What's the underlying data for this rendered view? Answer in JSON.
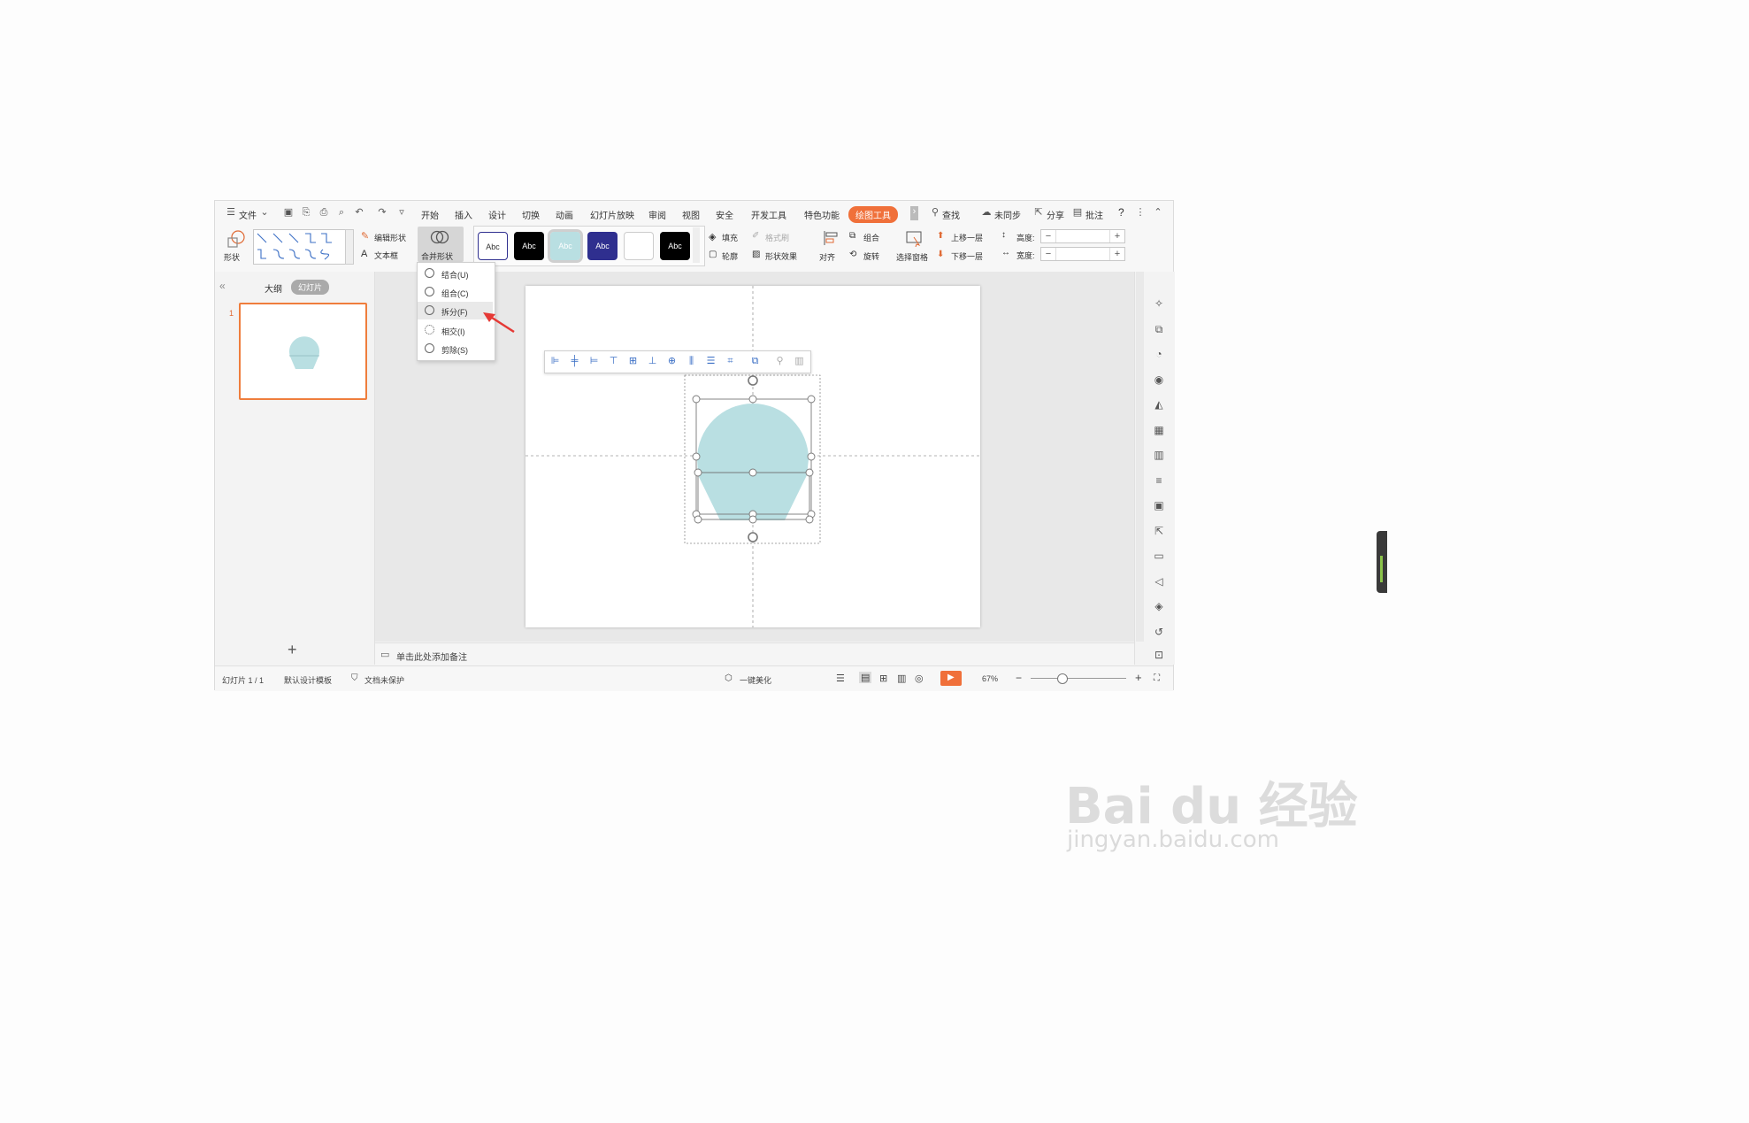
{
  "menubar": {
    "file": "文件",
    "tabs": [
      "开始",
      "插入",
      "设计",
      "切换",
      "动画",
      "幻灯片放映",
      "审阅",
      "视图",
      "安全",
      "开发工具",
      "特色功能"
    ],
    "active_tab": "绘图工具",
    "search": "查找",
    "sync": "未同步",
    "share": "分享",
    "comment": "批注",
    "help": "?"
  },
  "ribbon": {
    "shape": "形状",
    "edit_shape": "编辑形状",
    "textbox": "文本框",
    "merge_shape": "合并形状",
    "style_samples": [
      "Abc",
      "Abc",
      "Abc",
      "Abc",
      "",
      "Abc"
    ],
    "fill": "填充",
    "format_brush": "格式刷",
    "outline": "轮廓",
    "shape_effect": "形状效果",
    "align": "对齐",
    "group": "组合",
    "rotate": "旋转",
    "selection_pane": "选择窗格",
    "bring_forward": "上移一层",
    "send_backward": "下移一层",
    "height": "高度:",
    "width": "宽度:",
    "minus": "−",
    "plus": "+"
  },
  "left_panel": {
    "outline_tab": "大纲",
    "slides_tab": "幻灯片",
    "slide_number": "1",
    "add": "+",
    "collapse": "«"
  },
  "merge_menu": {
    "items": [
      "结合(U)",
      "组合(C)",
      "拆分(F)",
      "相交(I)",
      "剪除(S)"
    ],
    "highlighted": "拆分(F)"
  },
  "notes": {
    "placeholder": "单击此处添加备注"
  },
  "statusbar": {
    "slide_info": "幻灯片 1 / 1",
    "template": "默认设计模板",
    "protect": "文档未保护",
    "beautify": "一键美化",
    "zoom": "67%",
    "minus": "−",
    "plus": "+"
  },
  "colors": {
    "accent": "#f0703a",
    "shape_fill": "#b9dfe2",
    "style_dark_blue": "#2f2f8f",
    "style_teal": "#b9dfe2",
    "arrow": "#e53935"
  },
  "watermark": {
    "logo": "Bai du 经验",
    "url": "jingyan.baidu.com"
  }
}
